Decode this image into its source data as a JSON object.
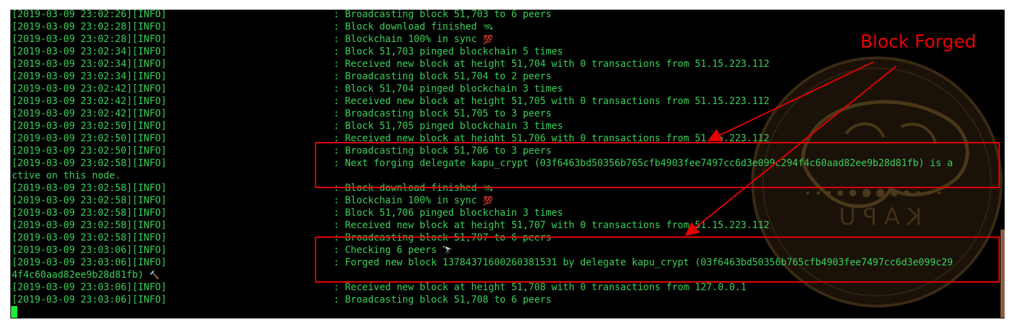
{
  "annotation": {
    "label": "Block Forged",
    "color": "#ee0000"
  },
  "terminal": {
    "text_color": "#39d15a",
    "cursor_color": "#19f032",
    "watermark_text": "KAPU",
    "lines": [
      {
        "prefix": "[2019-03-09 23:02:26][INFO]",
        "message": ": Broadcasting block 51,703 to 6 peers",
        "icon": ""
      },
      {
        "prefix": "[2019-03-09 23:02:28][INFO]",
        "message": ": Block download finished ",
        "icon": "🛰"
      },
      {
        "prefix": "[2019-03-09 23:02:28][INFO]",
        "message": ": Blockchain 100% in sync ",
        "icon": "💯"
      },
      {
        "prefix": "[2019-03-09 23:02:34][INFO]",
        "message": ": Block 51,703 pinged blockchain 5 times",
        "icon": ""
      },
      {
        "prefix": "[2019-03-09 23:02:34][INFO]",
        "message": ": Received new block at height 51,704 with 0 transactions from 51.15.223.112",
        "icon": ""
      },
      {
        "prefix": "[2019-03-09 23:02:34][INFO]",
        "message": ": Broadcasting block 51,704 to 2 peers",
        "icon": ""
      },
      {
        "prefix": "[2019-03-09 23:02:42][INFO]",
        "message": ": Block 51,704 pinged blockchain 3 times",
        "icon": ""
      },
      {
        "prefix": "[2019-03-09 23:02:42][INFO]",
        "message": ": Received new block at height 51,705 with 0 transactions from 51.15.223.112",
        "icon": ""
      },
      {
        "prefix": "[2019-03-09 23:02:42][INFO]",
        "message": ": Broadcasting block 51,705 to 3 peers",
        "icon": ""
      },
      {
        "prefix": "[2019-03-09 23:02:50][INFO]",
        "message": ": Block 51,705 pinged blockchain 3 times",
        "icon": ""
      },
      {
        "prefix": "[2019-03-09 23:02:50][INFO]",
        "message": ": Received new block at height 51,706 with 0 transactions from 51.15.223.112",
        "icon": ""
      },
      {
        "prefix": "[2019-03-09 23:02:50][INFO]",
        "message": ": Broadcasting block 51,706 to 3 peers",
        "icon": ""
      },
      {
        "prefix": "[2019-03-09 23:02:58][INFO]",
        "message": ": Next forging delegate kapu_crypt (03f6463bd50356b765cfb4903fee7497cc6d3e099c294f4c60aad82ee9b28d81fb) is a",
        "icon": ""
      },
      {
        "prefix": "",
        "message": "ctive on this node.",
        "icon": ""
      },
      {
        "prefix": "[2019-03-09 23:02:58][INFO]",
        "message": ": Block download finished ",
        "icon": "🛰"
      },
      {
        "prefix": "[2019-03-09 23:02:58][INFO]",
        "message": ": Blockchain 100% in sync ",
        "icon": "💯"
      },
      {
        "prefix": "[2019-03-09 23:02:58][INFO]",
        "message": ": Block 51,706 pinged blockchain 3 times",
        "icon": ""
      },
      {
        "prefix": "[2019-03-09 23:02:58][INFO]",
        "message": ": Received new block at height 51,707 with 0 transactions from 51.15.223.112",
        "icon": ""
      },
      {
        "prefix": "[2019-03-09 23:02:58][INFO]",
        "message": ": Broadcasting block 51,707 to 6 peers",
        "icon": ""
      },
      {
        "prefix": "[2019-03-09 23:03:06][INFO]",
        "message": ": Checking 6 peers ",
        "icon": "🔭"
      },
      {
        "prefix": "[2019-03-09 23:03:06][INFO]",
        "message": ": Forged new block 13784371600260381531 by delegate kapu_crypt (03f6463bd50356b765cfb4903fee7497cc6d3e099c29",
        "icon": ""
      },
      {
        "prefix": "",
        "message": "4f4c60aad82ee9b28d81fb) ",
        "icon": "🔨"
      },
      {
        "prefix": "[2019-03-09 23:03:06][INFO]",
        "message": ": Received new block at height 51,708 with 0 transactions from 127.0.0.1",
        "icon": ""
      },
      {
        "prefix": "[2019-03-09 23:03:06][INFO]",
        "message": ": Broadcasting block 51,708 to 6 peers",
        "icon": ""
      }
    ]
  }
}
